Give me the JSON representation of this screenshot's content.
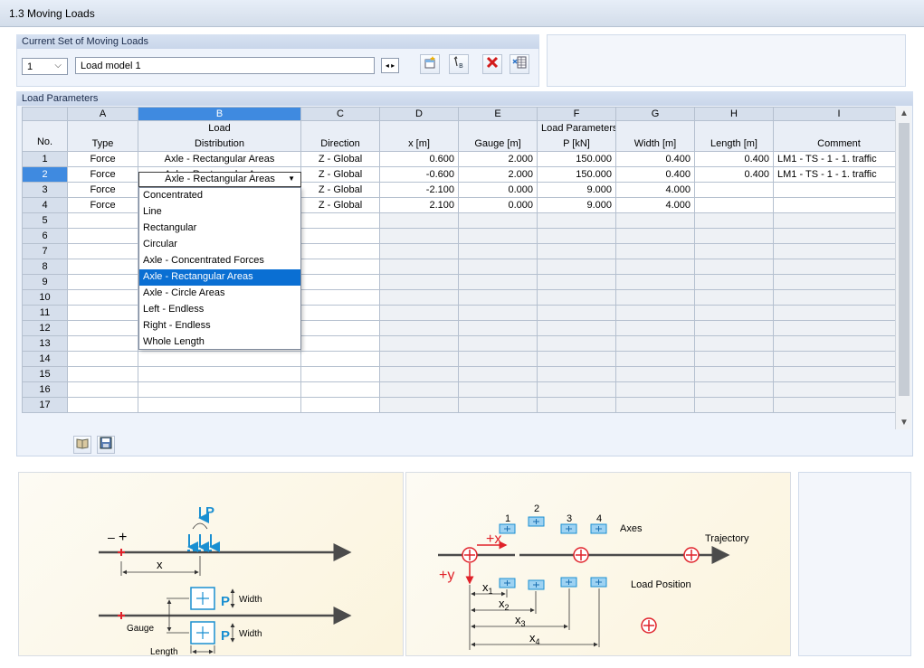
{
  "window": {
    "title": "1.3 Moving Loads"
  },
  "current_set": {
    "title": "Current Set of Moving Loads",
    "number": "1",
    "name": "Load model 1"
  },
  "load_parameters": {
    "title": "Load Parameters",
    "col_letters": [
      "A",
      "B",
      "C",
      "D",
      "E",
      "F",
      "G",
      "H",
      "I"
    ],
    "no_label": "No.",
    "group_load": "Load",
    "group_params": "Load Parameters",
    "headers": [
      "Type",
      "Distribution",
      "Direction",
      "x [m]",
      "Gauge [m]",
      "P [kN]",
      "Width [m]",
      "Length [m]",
      "Comment"
    ],
    "rows": [
      {
        "no": "1",
        "cells": [
          "Force",
          "Axle - Rectangular Areas",
          "Z - Global",
          "0.600",
          "2.000",
          "150.000",
          "0.400",
          "0.400",
          "LM1 - TS - 1 - 1. traffic"
        ]
      },
      {
        "no": "2",
        "cells": [
          "Force",
          "Axle - Rectangular Areas",
          "Z - Global",
          "-0.600",
          "2.000",
          "150.000",
          "0.400",
          "0.400",
          "LM1 - TS - 1 - 1. traffic"
        ]
      },
      {
        "no": "3",
        "cells": [
          "Force",
          "",
          "Z - Global",
          "-2.100",
          "0.000",
          "9.000",
          "4.000",
          "",
          ""
        ]
      },
      {
        "no": "4",
        "cells": [
          "Force",
          "",
          "Z - Global",
          "2.100",
          "0.000",
          "9.000",
          "4.000",
          "",
          ""
        ]
      },
      {
        "no": "5",
        "cells": [
          "",
          "",
          "",
          "",
          "",
          "",
          "",
          "",
          ""
        ]
      },
      {
        "no": "6",
        "cells": [
          "",
          "",
          "",
          "",
          "",
          "",
          "",
          "",
          ""
        ]
      },
      {
        "no": "7",
        "cells": [
          "",
          "",
          "",
          "",
          "",
          "",
          "",
          "",
          ""
        ]
      },
      {
        "no": "8",
        "cells": [
          "",
          "",
          "",
          "",
          "",
          "",
          "",
          "",
          ""
        ]
      },
      {
        "no": "9",
        "cells": [
          "",
          "",
          "",
          "",
          "",
          "",
          "",
          "",
          ""
        ]
      },
      {
        "no": "10",
        "cells": [
          "",
          "",
          "",
          "",
          "",
          "",
          "",
          "",
          ""
        ]
      },
      {
        "no": "11",
        "cells": [
          "",
          "",
          "",
          "",
          "",
          "",
          "",
          "",
          ""
        ]
      },
      {
        "no": "12",
        "cells": [
          "",
          "",
          "",
          "",
          "",
          "",
          "",
          "",
          ""
        ]
      },
      {
        "no": "13",
        "cells": [
          "",
          "",
          "",
          "",
          "",
          "",
          "",
          "",
          ""
        ]
      },
      {
        "no": "14",
        "cells": [
          "",
          "",
          "",
          "",
          "",
          "",
          "",
          "",
          ""
        ]
      },
      {
        "no": "15",
        "cells": [
          "",
          "",
          "",
          "",
          "",
          "",
          "",
          "",
          ""
        ]
      },
      {
        "no": "16",
        "cells": [
          "",
          "",
          "",
          "",
          "",
          "",
          "",
          "",
          ""
        ]
      },
      {
        "no": "17",
        "cells": [
          "",
          "",
          "",
          "",
          "",
          "",
          "",
          "",
          ""
        ]
      }
    ],
    "edit_value": "Axle - Rectangular Areas",
    "dropdown_options": [
      "Concentrated",
      "Line",
      "Rectangular",
      "Circular",
      "Axle - Concentrated Forces",
      "Axle - Rectangular Areas",
      "Axle - Circle Areas",
      "Left - Endless",
      "Right - Endless",
      "Whole Length"
    ],
    "dropdown_selected": "Axle - Rectangular Areas"
  },
  "diagram_left": {
    "p": "P",
    "minus": "–",
    "plus": "+",
    "x": "x",
    "width": "Width",
    "gauge": "Gauge",
    "length": "Length"
  },
  "diagram_right": {
    "axes_numbers": [
      "1",
      "2",
      "3",
      "4"
    ],
    "axes": "Axes",
    "trajectory": "Trajectory",
    "plus_x": "+x",
    "plus_y": "+y",
    "load_position": "Load Position",
    "x1": "x",
    "x1_sub": "1",
    "x2": "x",
    "x2_sub": "2",
    "x3": "x",
    "x3_sub": "3",
    "x4": "x",
    "x4_sub": "4"
  },
  "colors": {
    "accent_blue": "#1a8fd1",
    "red": "#e0222a",
    "header_selected": "#3f8ae0"
  }
}
